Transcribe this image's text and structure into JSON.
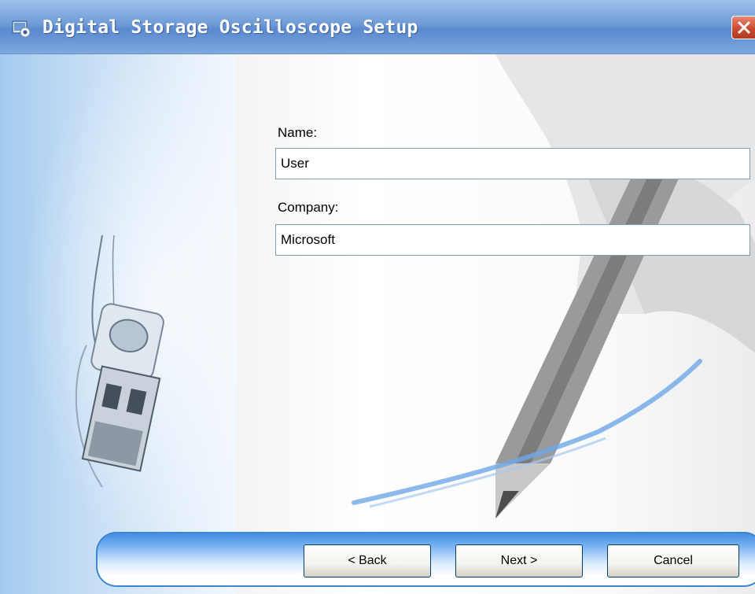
{
  "window": {
    "title": "Digital Storage Oscilloscope Setup",
    "close_icon": "close-icon",
    "app_icon": "setup-app-icon"
  },
  "form": {
    "name_label": "Name:",
    "name_value": "User",
    "company_label": "Company:",
    "company_value": "Microsoft"
  },
  "buttons": {
    "back_label": "< Back",
    "next_label": "Next >",
    "cancel_label": "Cancel"
  },
  "colors": {
    "title_bar": "#6f9bd7",
    "close_button": "#c94a31",
    "button_bar": "#3f8ae0"
  }
}
